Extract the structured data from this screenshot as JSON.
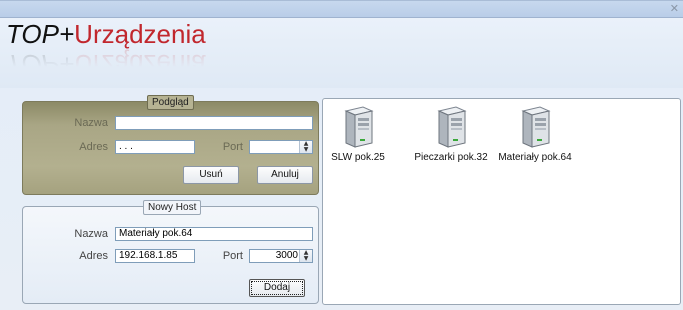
{
  "window": {
    "close_glyph": "✕"
  },
  "logo": {
    "part1": "TOP+",
    "part2": "Urządzenia"
  },
  "preview": {
    "legend": "Podgląd",
    "name_label": "Nazwa",
    "name_value": "",
    "address_label": "Adres",
    "address_value": ". . .",
    "port_label": "Port",
    "port_value": "",
    "delete_label": "Usuń",
    "cancel_label": "Anuluj"
  },
  "new_host": {
    "legend": "Nowy Host",
    "name_label": "Nazwa",
    "name_value": "Materiały pok.64",
    "address_label": "Adres",
    "address_value": "192.168.1.85",
    "port_label": "Port",
    "port_value": "3000",
    "add_label": "Dodaj"
  },
  "devices": [
    {
      "label": "SLW pok.25",
      "icon": "server-icon"
    },
    {
      "label": "Pieczarki pok.32",
      "icon": "server-icon"
    },
    {
      "label": "Materiały pok.64",
      "icon": "server-icon"
    }
  ],
  "colors": {
    "brand_red": "#c1272d",
    "preview_panel": "#b3b08f",
    "field_border": "#7f9db9"
  }
}
